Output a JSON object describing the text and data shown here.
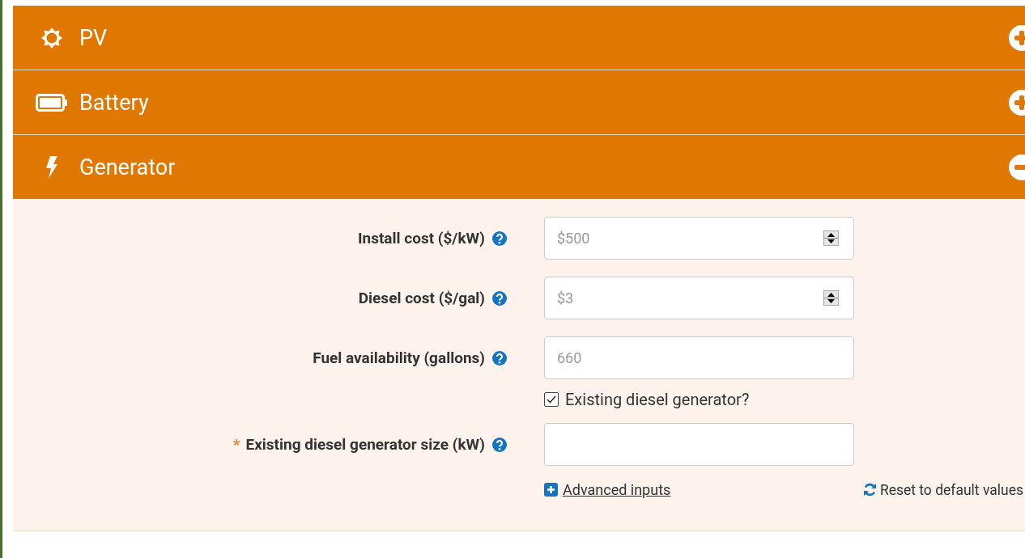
{
  "sections": [
    {
      "kind": "pv",
      "title": "PV",
      "expanded": false
    },
    {
      "kind": "battery",
      "title": "Battery",
      "expanded": false
    },
    {
      "kind": "generator",
      "title": "Generator",
      "expanded": true
    }
  ],
  "generator_fields": [
    {
      "kind": "number",
      "label": "Install cost ($/kW)",
      "placeholder": "$500"
    },
    {
      "kind": "number",
      "label": "Diesel cost ($/gal)",
      "placeholder": "$3"
    },
    {
      "kind": "text",
      "label": "Fuel availability (gallons)",
      "placeholder": "660"
    },
    {
      "kind": "checkbox",
      "label": "Existing diesel generator?",
      "checked": true
    },
    {
      "kind": "text",
      "label": "Existing diesel generator size (kW)",
      "required_mark": "*"
    }
  ],
  "advanced_link": "Advanced inputs",
  "reset_link": "Reset to default values"
}
